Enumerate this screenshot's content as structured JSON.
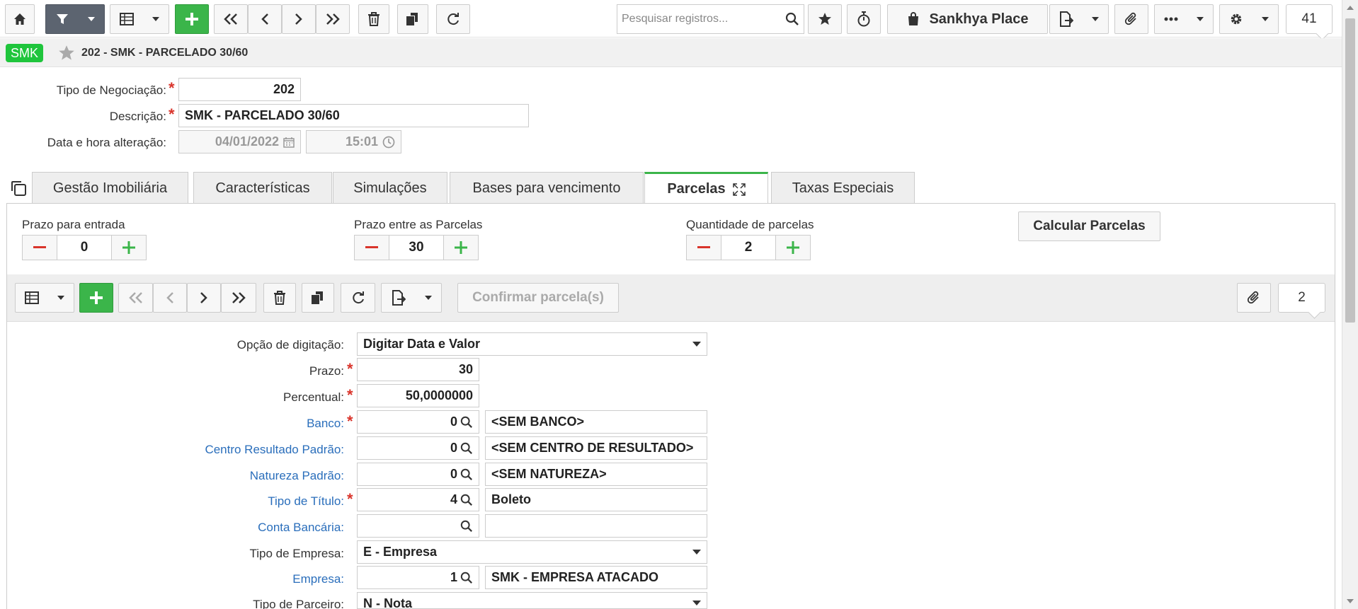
{
  "toolbar": {
    "search_placeholder": "Pesquisar registros...",
    "place_label": "Sankhya Place",
    "record_count": "41"
  },
  "header": {
    "badge": "SMK",
    "title": "202 - SMK - PARCELADO 30/60"
  },
  "form": {
    "tipo_label": "Tipo de Negociação:",
    "tipo_value": "202",
    "descricao_label": "Descrição:",
    "descricao_value": "SMK - PARCELADO 30/60",
    "data_label": "Data e hora alteração:",
    "data_value": "04/01/2022",
    "hora_value": "15:01"
  },
  "tabs": [
    {
      "label": "Gestão Imobiliária"
    },
    {
      "label": "Características"
    },
    {
      "label": "Simulações"
    },
    {
      "label": "Bases para vencimento"
    },
    {
      "label": "Parcelas"
    },
    {
      "label": "Taxas Especiais"
    }
  ],
  "parcelas": {
    "prazo_entrada_label": "Prazo para entrada",
    "prazo_entrada_value": "0",
    "prazo_entre_label": "Prazo entre as Parcelas",
    "prazo_entre_value": "30",
    "quantidade_label": "Quantidade de parcelas",
    "quantidade_value": "2",
    "calcular_label": "Calcular Parcelas",
    "confirmar_label": "Confirmar parcela(s)",
    "record_count": "2"
  },
  "detail": {
    "opcao_label": "Opção de digitação:",
    "opcao_value": "Digitar Data e Valor",
    "prazo_label": "Prazo:",
    "prazo_value": "30",
    "percentual_label": "Percentual:",
    "percentual_value": "50,0000000",
    "banco_label": "Banco:",
    "banco_code": "0",
    "banco_desc": "<SEM BANCO>",
    "centro_label": "Centro Resultado Padrão:",
    "centro_code": "0",
    "centro_desc": "<SEM CENTRO DE RESULTADO>",
    "natureza_label": "Natureza Padrão:",
    "natureza_code": "0",
    "natureza_desc": "<SEM NATUREZA>",
    "tipotitulo_label": "Tipo de Título:",
    "tipotitulo_code": "4",
    "tipotitulo_desc": "Boleto",
    "conta_label": "Conta Bancária:",
    "conta_code": "",
    "conta_desc": "",
    "tipoempresa_label": "Tipo de Empresa:",
    "tipoempresa_value": "E - Empresa",
    "empresa_label": "Empresa:",
    "empresa_code": "1",
    "empresa_desc": "SMK - EMPRESA ATACADO",
    "tipoparceiro_label": "Tipo de Parceiro:",
    "tipoparceiro_value": "N - Nota"
  },
  "colors": {
    "accent_green": "#3bb54a",
    "badge_green": "#1fc53c",
    "link_blue": "#2a6ebb",
    "required_red": "#d9342b"
  }
}
